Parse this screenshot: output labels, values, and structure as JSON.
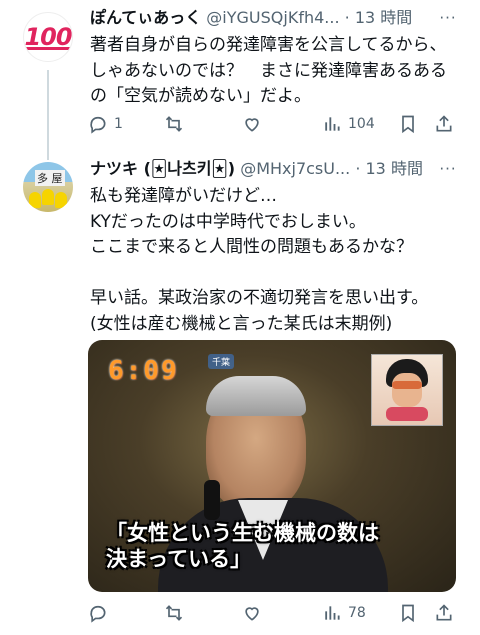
{
  "tweet1": {
    "avatar_emoji": "100",
    "name": "ぽんてぃあっく",
    "handle": "@iYGUSQjKfh4...",
    "dot": "·",
    "time": "13 時間",
    "more": "···",
    "text": "著者自身が自らの発達障害を公言してるから、\nしゃあないのでは？　まさに発達障害あるある\nの「空気が読めない」だよ。",
    "reply_count": "1",
    "retweet_count": "",
    "like_count": "",
    "views_count": "104"
  },
  "tweet2": {
    "avatar_text": "多 屋",
    "name": "ナツキ (🃏나츠키🃏)",
    "handle": "@MHxj7csU...",
    "dot": "·",
    "time": "13 時間",
    "more": "···",
    "text": "私も発達障がいだけど…\nKYだったのは中学時代でおしまい。\nここまで来ると人間性の問題もあるかな？\n\n早い話。某政治家の不適切発言を思い出す。\n(女性は産む機械と言った某氏は末期例)",
    "media": {
      "clock": "6:09",
      "channel": "千葉",
      "caption": "「女性という生む機械の数は\n決まっている」"
    },
    "reply_count": "",
    "retweet_count": "",
    "like_count": "",
    "views_count": "78"
  }
}
